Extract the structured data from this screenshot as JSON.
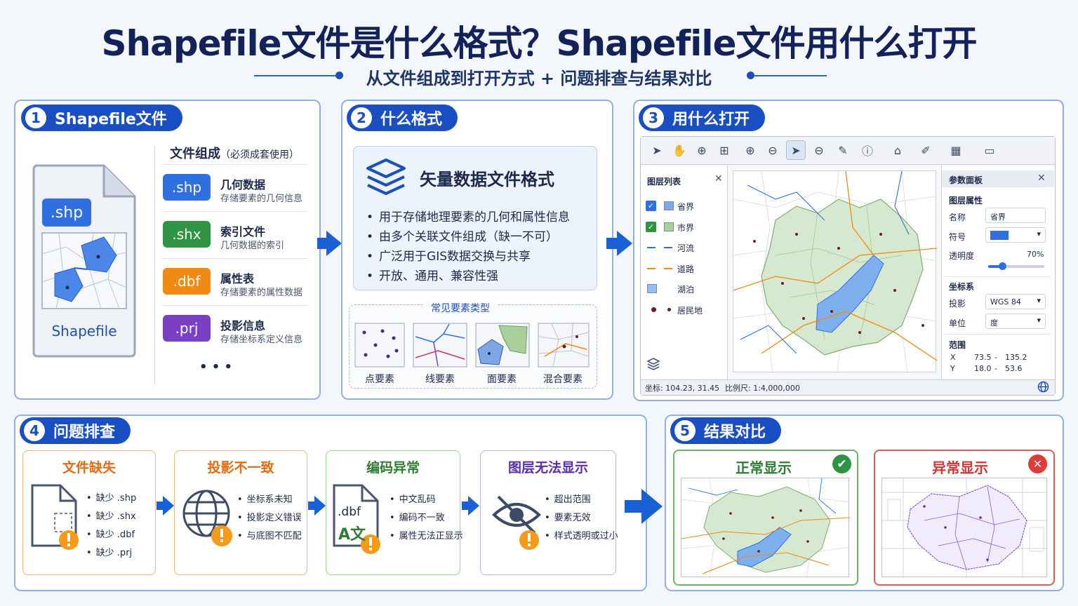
{
  "header": {
    "title": "Shapefile文件是什么格式？Shapefile文件用什么打开",
    "subtitle": "从文件组成到打开方式 + 问题排查与结果对比"
  },
  "section1": {
    "num": "1",
    "title": "Shapefile文件",
    "icon_label": ".shp",
    "caption": "Shapefile",
    "components_title": "文件组成",
    "components_note": "（必须成套使用）",
    "components": [
      {
        "ext": ".shp",
        "name": "几何数据",
        "desc": "存储要素的几何信息",
        "color": "#2f6fe0"
      },
      {
        "ext": ".shx",
        "name": "索引文件",
        "desc": "几何数据的索引",
        "color": "#2e9444"
      },
      {
        "ext": ".dbf",
        "name": "属性表",
        "desc": "存储要素的属性数据",
        "color": "#f08a12"
      },
      {
        "ext": ".prj",
        "name": "投影信息",
        "desc": "存储坐标系定义信息",
        "color": "#7b3fc6"
      }
    ],
    "more": "• • •"
  },
  "section2": {
    "num": "2",
    "title": "什么格式",
    "heading": "矢量数据文件格式",
    "bullets": [
      "用于存储地理要素的几何和属性信息",
      "由多个关联文件组成（缺一不可）",
      "广泛用于GIS数据交换与共享",
      "开放、通用、兼容性强"
    ],
    "types_title": "常见要素类型",
    "types": [
      "点要素",
      "线要素",
      "面要素",
      "混合要素"
    ]
  },
  "section3": {
    "num": "3",
    "title": "用什么打开",
    "toolbar_icons": [
      "pointer-icon",
      "pan-icon",
      "zoom-in-icon",
      "zoom-extent-icon",
      "zoom-in-2-icon",
      "zoom-out-icon",
      "select-icon",
      "zoom-out-2-icon",
      "draw-icon",
      "identify-icon",
      "home-icon",
      "edit-icon",
      "grid-icon",
      "layout-icon"
    ],
    "layers_title": "图层列表",
    "layers": [
      {
        "name": "省界",
        "type": "fill",
        "color": "#7fa7e6",
        "checked": true
      },
      {
        "name": "市界",
        "type": "fill",
        "color": "#a9cf9a",
        "checked": true
      },
      {
        "name": "河流",
        "type": "line",
        "color": "#2f6fe0"
      },
      {
        "name": "道路",
        "type": "line",
        "color": "#f08a12"
      },
      {
        "name": "湖泊",
        "type": "fill",
        "color": "#8fc0f5"
      },
      {
        "name": "居民地",
        "type": "point",
        "color": "#6a1a2a"
      }
    ],
    "props": {
      "title": "参数面板",
      "layer_props": "图层属性",
      "name_label": "名称",
      "name_value": "省界",
      "symbol_label": "符号",
      "symbol_color": "#2f6fe0",
      "opacity_label": "透明度",
      "opacity_value": "70%",
      "opacity_fraction": 0.25,
      "crs_title": "坐标系",
      "proj_label": "投影",
      "proj_value": "WGS 84",
      "unit_label": "单位",
      "unit_value": "度",
      "extent_title": "范围",
      "x_label": "X",
      "x_min": "73.5",
      "x_max": "135.2",
      "y_label": "Y",
      "y_min": "18.0",
      "y_max": "53.6",
      "dash": "-"
    },
    "status": {
      "coords": "坐标: 104.23, 31.45",
      "scale": "比例尺: 1:4,000,000"
    }
  },
  "section4": {
    "num": "4",
    "title": "问题排查",
    "cards": [
      {
        "title": "文件缺失",
        "color": "#e56a10",
        "border": "#f2b774",
        "items": [
          "缺少 .shp",
          "缺少 .shx",
          "缺少 .dbf",
          "缺少 .prj"
        ]
      },
      {
        "title": "投影不一致",
        "color": "#e56a10",
        "border": "#f2b774",
        "items": [
          "坐标系未知",
          "投影定义错误",
          "与底图不匹配"
        ]
      },
      {
        "title": "编码异常",
        "color": "#2e7d32",
        "border": "#9fd19a",
        "items": [
          "中文乱码",
          "编码不一致",
          "属性无法正显示"
        ],
        "icon_text": ".dbf",
        "icon_glyph": "A文"
      },
      {
        "title": "图层无法显示",
        "color": "#5a2ea6",
        "border": "#c4aee8",
        "items": [
          "超出范围",
          "要素无效",
          "样式透明或过小"
        ]
      }
    ]
  },
  "section5": {
    "num": "5",
    "title": "结果对比",
    "normal": "正常显示",
    "abnormal": "异常显示"
  }
}
